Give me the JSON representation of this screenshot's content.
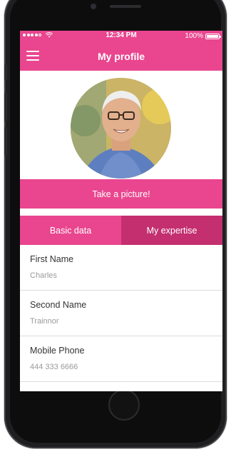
{
  "status_bar": {
    "time": "12:34 PM",
    "battery": "100%",
    "signal_icon": "signal-dots-icon",
    "wifi_icon": "wifi-icon",
    "battery_icon": "battery-icon"
  },
  "nav": {
    "title": "My profile",
    "menu_icon": "hamburger-icon"
  },
  "profile": {
    "avatar": "profile-photo",
    "take_picture_label": "Take a picture!"
  },
  "tabs": [
    {
      "label": "Basic data",
      "active": true
    },
    {
      "label": "My expertise",
      "active": false
    }
  ],
  "fields": [
    {
      "label": "First Name",
      "value": "Charles"
    },
    {
      "label": "Second Name",
      "value": "Trainnor"
    },
    {
      "label": "Mobile Phone",
      "value": "444 333 6666"
    }
  ],
  "colors": {
    "accent": "#e9468f",
    "accent_dark": "#c32f6f",
    "label_text": "#333333",
    "value_text": "#9a9a9a"
  }
}
